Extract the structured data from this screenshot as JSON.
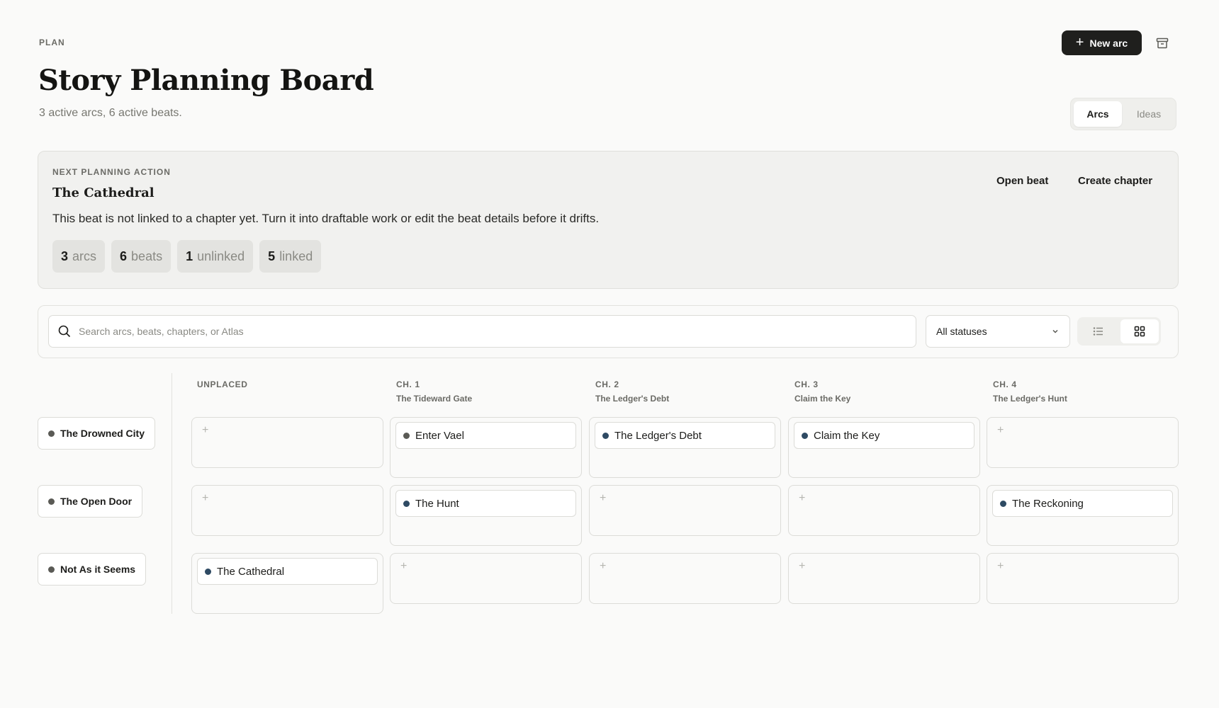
{
  "header": {
    "eyebrow": "PLAN",
    "title": "Story Planning Board",
    "subtitle": "3 active arcs, 6 active beats.",
    "new_arc_label": "New arc",
    "view_tabs": [
      {
        "label": "Arcs",
        "active": true
      },
      {
        "label": "Ideas",
        "active": false
      }
    ]
  },
  "next_action": {
    "eyebrow": "NEXT PLANNING ACTION",
    "title": "The Cathedral",
    "description": "This beat is not linked to a chapter yet. Turn it into draftable work or edit the beat details before it drifts.",
    "open_beat_label": "Open beat",
    "create_chapter_label": "Create chapter",
    "stats": [
      {
        "num": "3",
        "label": "arcs"
      },
      {
        "num": "6",
        "label": "beats"
      },
      {
        "num": "1",
        "label": "unlinked"
      },
      {
        "num": "5",
        "label": "linked"
      }
    ]
  },
  "filters": {
    "search_placeholder": "Search arcs, beats, chapters, or Atlas",
    "search_value": "",
    "status_selected": "All statuses",
    "view_mode": "grid"
  },
  "board": {
    "columns": [
      {
        "ch": "UNPLACED",
        "sub": ""
      },
      {
        "ch": "CH. 1",
        "sub": "The Tideward Gate"
      },
      {
        "ch": "CH. 2",
        "sub": "The Ledger's Debt"
      },
      {
        "ch": "CH. 3",
        "sub": "Claim the Key"
      },
      {
        "ch": "CH. 4",
        "sub": "The Ledger's Hunt"
      }
    ],
    "arcs": [
      {
        "name": "The Drowned City",
        "cells": [
          "",
          "Enter Vael",
          "The Ledger's Debt",
          "Claim the Key",
          ""
        ]
      },
      {
        "name": "The Open Door",
        "cells": [
          "",
          "The Hunt",
          "",
          "",
          "The Reckoning"
        ]
      },
      {
        "name": "Not As it Seems",
        "cells": [
          "The Cathedral",
          "",
          "",
          "",
          ""
        ]
      }
    ],
    "add_glyph": "+"
  },
  "colors": {
    "accent_dark": "#1f1f1d",
    "beat_dot": "#2e4a63",
    "arc_dot": "#5a5a55",
    "background": "#fafaf9"
  },
  "icons": {
    "new_arc": "plus-icon",
    "archive": "archive-icon",
    "search": "search-icon",
    "select": "chevron-down-icon",
    "list_view": "list-icon",
    "grid_view": "grid-icon"
  }
}
